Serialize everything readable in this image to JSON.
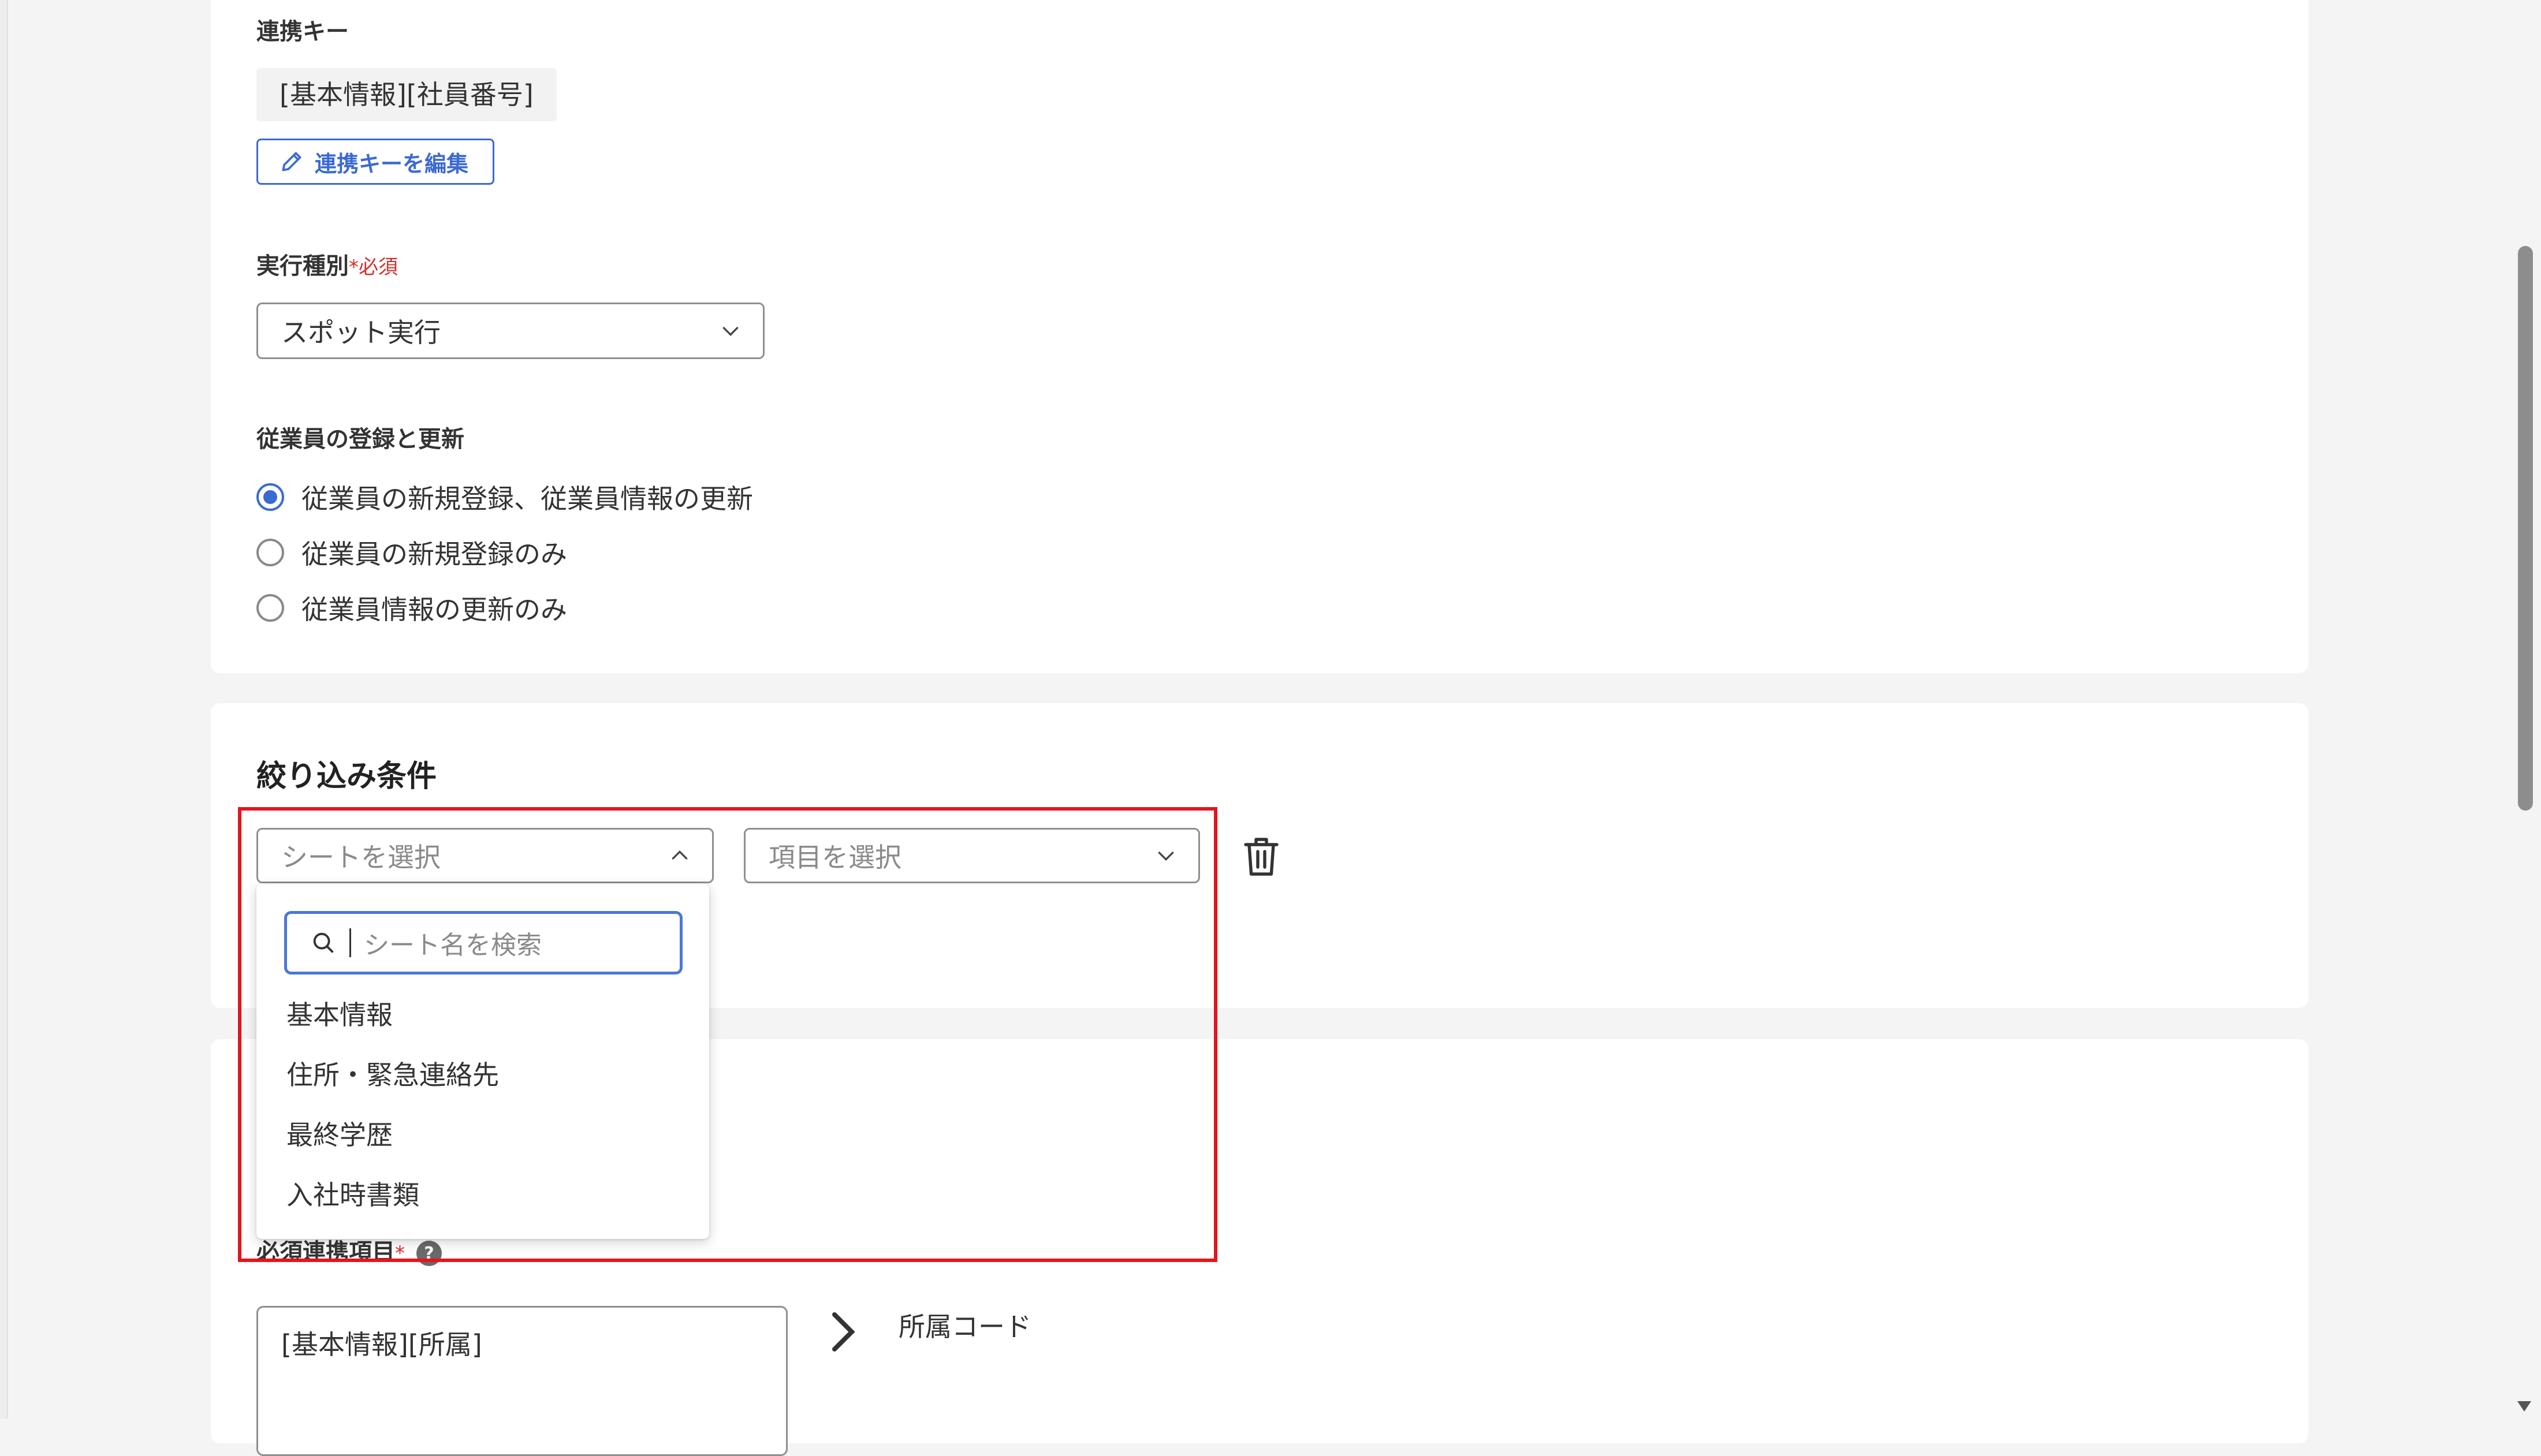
{
  "linkage_key": {
    "label": "連携キー",
    "value": "[基本情報][社員番号]",
    "edit_button_label": "連携キーを編集"
  },
  "execution_type": {
    "label": "実行種別",
    "required_mark": "*",
    "required_text": "必須",
    "selected_value": "スポット実行"
  },
  "employee_registration": {
    "label": "従業員の登録と更新",
    "options": [
      {
        "label": "従業員の新規登録、従業員情報の更新",
        "checked": true
      },
      {
        "label": "従業員の新規登録のみ",
        "checked": false
      },
      {
        "label": "従業員情報の更新のみ",
        "checked": false
      }
    ]
  },
  "filter_conditions": {
    "title": "絞り込み条件",
    "sheet_select_placeholder": "シートを選択",
    "item_select_placeholder": "項目を選択",
    "sheet_dropdown": {
      "search_placeholder": "シート名を検索",
      "options": [
        "基本情報",
        "住所・緊急連絡先",
        "最終学歴",
        "入社時書類"
      ]
    },
    "highlight_color": "#e5141b"
  },
  "required_link_items": {
    "label": "必須連携項目",
    "required_mark": "*",
    "help_icon_text": "?",
    "source_value": "[基本情報][所属]",
    "target_label": "所属コード"
  },
  "colors": {
    "accent": "#3b6ad1",
    "required": "#d0302c"
  },
  "icons": {
    "edit": "pencil-icon",
    "chevron_down": "chevron-down-icon",
    "chevron_up": "chevron-up-icon",
    "search": "search-icon",
    "delete": "trash-icon",
    "arrow": "chevron-right-icon",
    "help": "help-icon"
  }
}
